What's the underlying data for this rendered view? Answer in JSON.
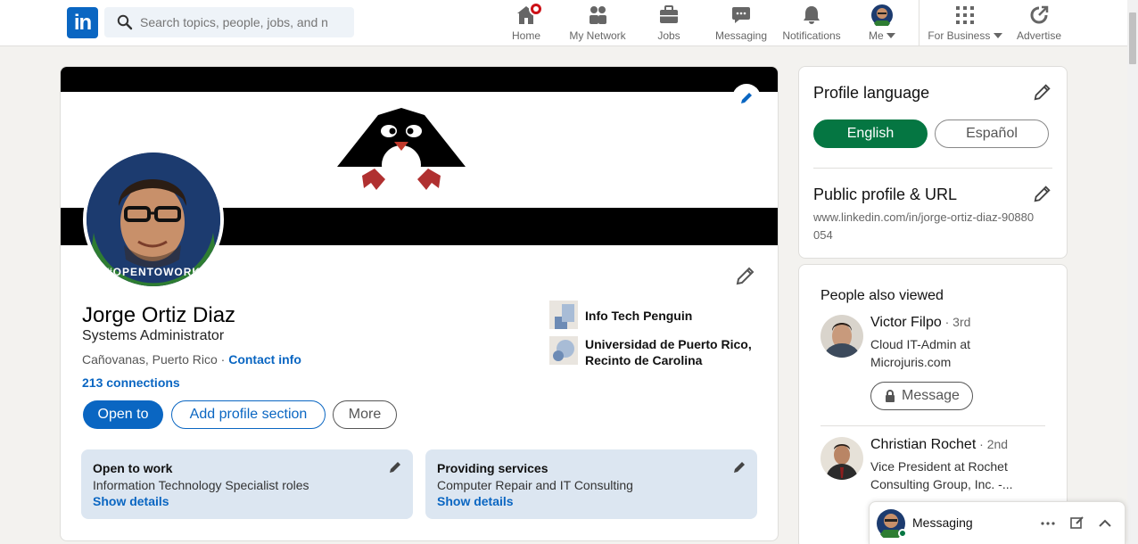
{
  "search": {
    "placeholder": "Search topics, people, jobs, and n"
  },
  "nav": {
    "home": "Home",
    "network": "My Network",
    "jobs": "Jobs",
    "messaging": "Messaging",
    "notifications": "Notifications",
    "me": "Me",
    "business": "For Business",
    "advertise": "Advertise"
  },
  "profile": {
    "name": "Jorge Ortiz Diaz",
    "headline": "Systems Administrator",
    "location": "Cañovanas, Puerto Rico",
    "location_sep": " · ",
    "contact_info": "Contact info",
    "connections": "213 connections",
    "avatar_frame_text": "#OPENTOWORK",
    "buttons": {
      "open_to": "Open to",
      "add_section": "Add profile section",
      "more": "More"
    },
    "orgs": [
      {
        "name": "Info Tech Penguin"
      },
      {
        "name": "Universidad de Puerto Rico, Recinto de Carolina"
      }
    ],
    "open_cards": [
      {
        "title": "Open to work",
        "desc": "Information Technology Specialist roles",
        "link": "Show details"
      },
      {
        "title": "Providing services",
        "desc": "Computer Repair and IT Consulting",
        "link": "Show details"
      }
    ]
  },
  "sidebar": {
    "profile_language": {
      "title": "Profile language",
      "english": "English",
      "spanish": "Español"
    },
    "public_profile": {
      "title": "Public profile & URL",
      "url": "www.linkedin.com/in/jorge-ortiz-diaz-90880054"
    },
    "people_also_viewed": {
      "title": "People also viewed",
      "people": [
        {
          "name": "Victor Filpo",
          "degree": " · 3rd",
          "title": "Cloud IT-Admin at Microjuris.com",
          "button": "Message"
        },
        {
          "name": "Christian Rochet",
          "degree": " · 2nd",
          "title": "Vice President at Rochet Consulting Group, Inc. -..."
        }
      ]
    }
  },
  "messaging_bar": {
    "label": "Messaging"
  },
  "colors": {
    "brand": "#0a66c2",
    "open_to_work_green": "#057642",
    "notification": "#cc1016"
  }
}
